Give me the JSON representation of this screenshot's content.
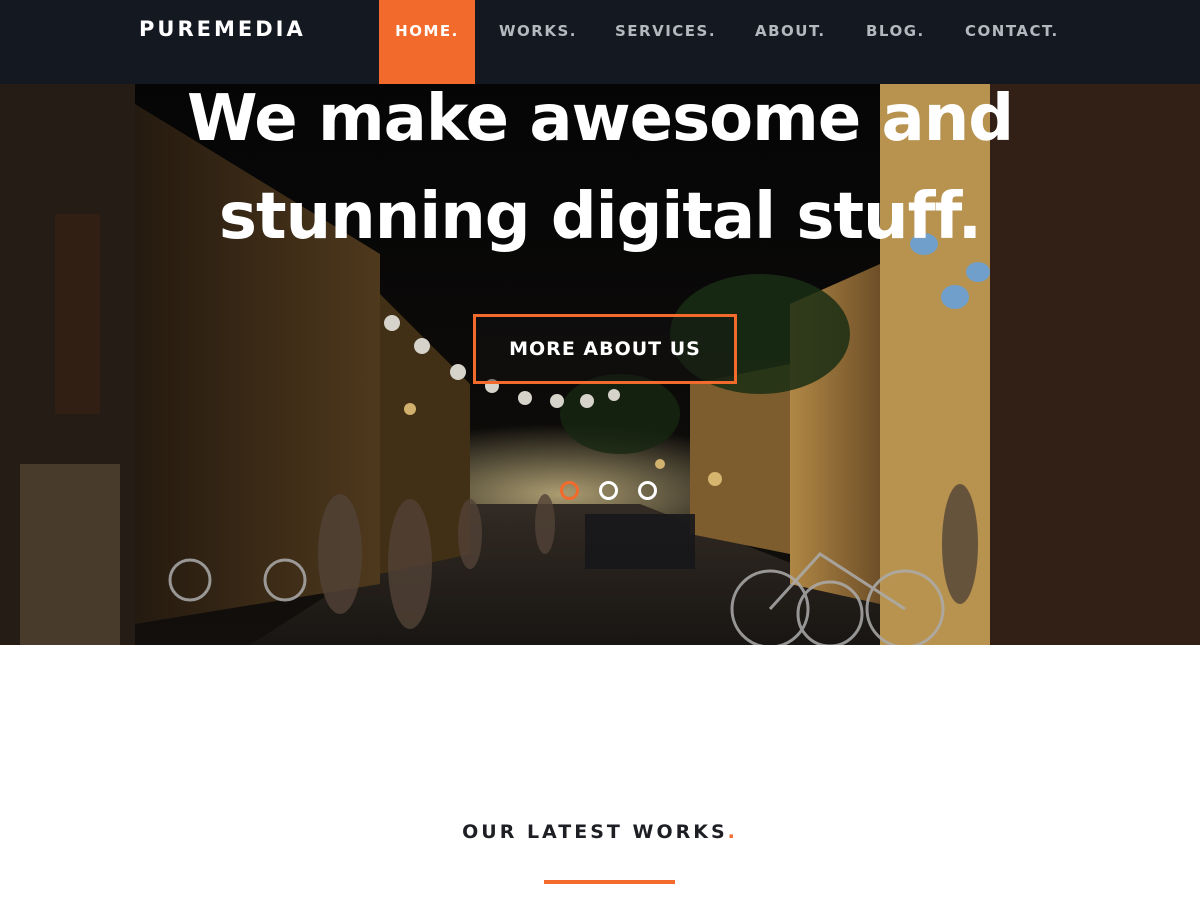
{
  "brand": "PUREMEDIA",
  "nav": {
    "items": [
      {
        "label": "HOME.",
        "active": true
      },
      {
        "label": "WORKS.",
        "active": false
      },
      {
        "label": "SERVICES.",
        "active": false
      },
      {
        "label": "ABOUT.",
        "active": false
      },
      {
        "label": "BLOG.",
        "active": false
      },
      {
        "label": "CONTACT.",
        "active": false
      }
    ]
  },
  "hero": {
    "heading_line1": "We make awesome and",
    "heading_line2": "stunning digital stuff.",
    "cta_label": "MORE ABOUT US",
    "slides_count": 3,
    "active_slide": 1
  },
  "works": {
    "title": "OUR LATEST WORKS",
    "title_suffix": "."
  },
  "colors": {
    "accent": "#f26a2c",
    "nav_bg": "#141821",
    "nav_text": "#b4b8bf",
    "heading_dark": "#1d1f24"
  },
  "icons": {
    "slider_dot": "circle-outline"
  }
}
